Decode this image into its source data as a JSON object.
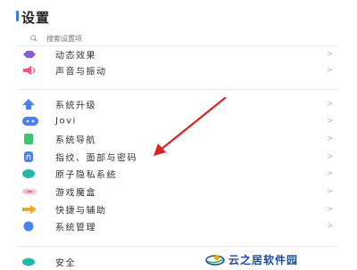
{
  "header": {
    "title": "设置"
  },
  "search": {
    "placeholder": "搜索设置项"
  },
  "items": [
    {
      "label": "动态效果",
      "icon": "diamond-icon",
      "color": "#8a5bd6"
    },
    {
      "label": "声音与振动",
      "icon": "speaker-icon",
      "color": "#f0587a"
    },
    {
      "label": "系统升级",
      "icon": "arrow-up-icon",
      "color": "#4a82f0"
    },
    {
      "label": "Jovi",
      "icon": "jovi-icon",
      "color": "#4a82f0"
    },
    {
      "label": "系统导航",
      "icon": "navigation-icon",
      "color": "#3cc46e"
    },
    {
      "label": "指纹、面部与密码",
      "icon": "fingerprint-icon",
      "color": "#4a82f0"
    },
    {
      "label": "原子隐私系统",
      "icon": "privacy-icon",
      "color": "#25b7a8"
    },
    {
      "label": "游戏魔盒",
      "icon": "game-icon",
      "color": "#f06a8a"
    },
    {
      "label": "快捷与辅助",
      "icon": "shortcut-icon",
      "color": "#f4a428"
    },
    {
      "label": "系统管理",
      "icon": "system-manage-icon",
      "color": "#4a82f0"
    },
    {
      "label": "安全",
      "icon": "security-icon",
      "color": "#25b7a8"
    }
  ],
  "chevron": ">",
  "annotation": {
    "color": "#e02020"
  },
  "watermark": {
    "text": "云之居软件园"
  }
}
